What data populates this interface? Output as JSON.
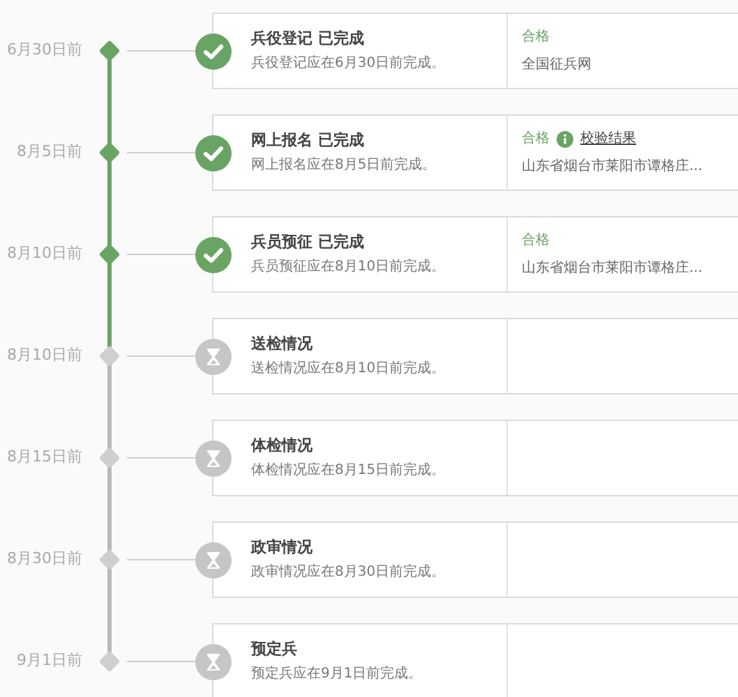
{
  "steps": [
    {
      "date": "6月30日前",
      "title": "兵役登记",
      "status": "已完成",
      "description": "兵役登记应在6月30日前完成。",
      "done": true,
      "result": {
        "label": "合格",
        "detail": "全国征兵网"
      }
    },
    {
      "date": "8月5日前",
      "title": "网上报名",
      "status": "已完成",
      "description": "网上报名应在8月5日前完成。",
      "done": true,
      "result": {
        "label": "合格",
        "link": "校验结果",
        "detail": "山东省烟台市莱阳市谭格庄..."
      }
    },
    {
      "date": "8月10日前",
      "title": "兵员预征",
      "status": "已完成",
      "description": "兵员预征应在8月10日前完成。",
      "done": true,
      "result": {
        "label": "合格",
        "detail": "山东省烟台市莱阳市谭格庄..."
      }
    },
    {
      "date": "8月10日前",
      "title": "送检情况",
      "description": "送检情况应在8月10日前完成。",
      "done": false
    },
    {
      "date": "8月15日前",
      "title": "体检情况",
      "description": "体检情况应在8月15日前完成。",
      "done": false
    },
    {
      "date": "8月30日前",
      "title": "政审情况",
      "description": "政审情况应在8月30日前完成。",
      "done": false
    },
    {
      "date": "9月1日前",
      "title": "预定兵",
      "description": "预定兵应在9月1日前完成。",
      "done": false
    }
  ]
}
